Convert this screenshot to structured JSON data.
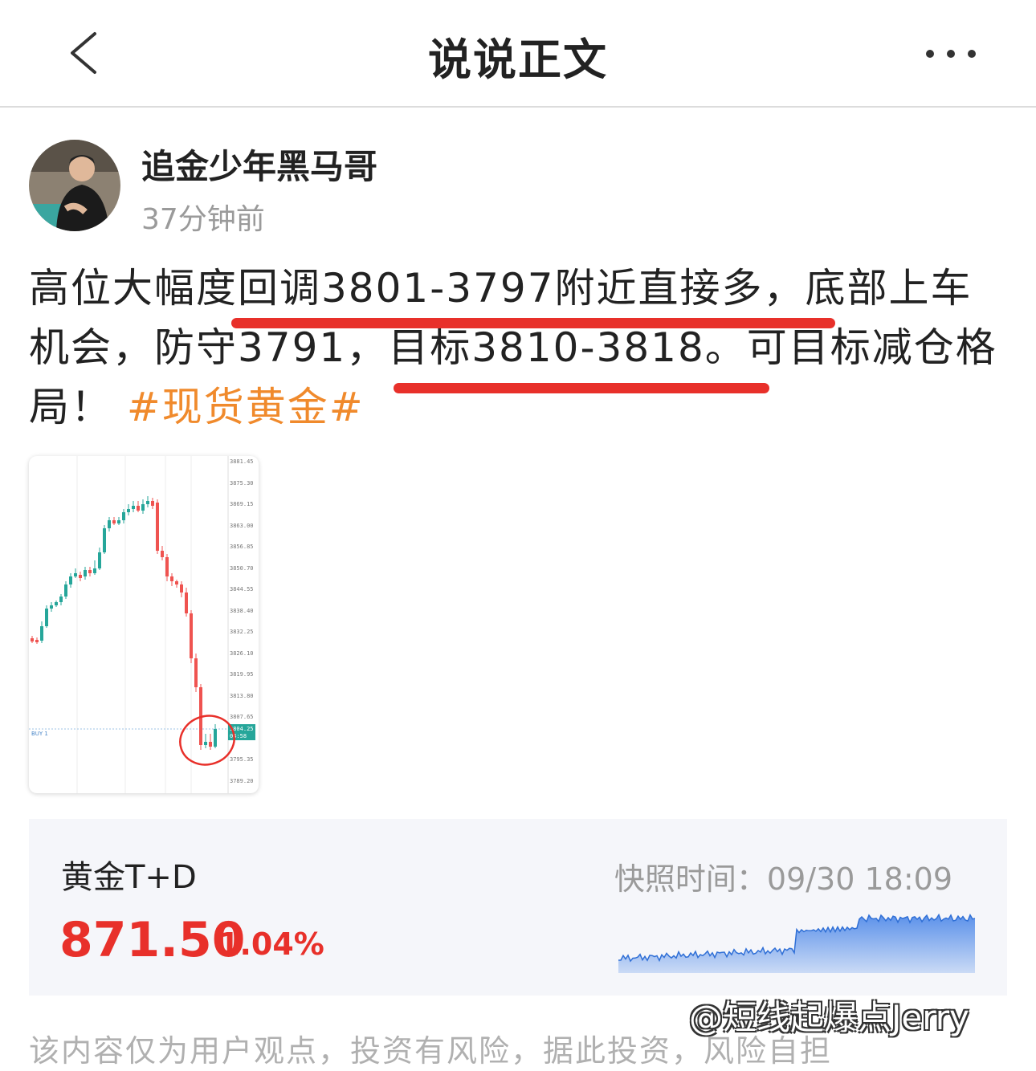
{
  "header": {
    "title": "说说正文",
    "back_icon": "chevron-left-icon",
    "more_icon": "more-dots-icon"
  },
  "post": {
    "author": "追金少年黑马哥",
    "time": "37分钟前",
    "text_line1": "高位大幅度回调3801-3797附近直接多，底部上车",
    "text_line2": "机会，防守3791，目标3810-3818。可目标减仓格",
    "text_line3": "局！",
    "hashtag": "#现货黄金#",
    "highlight_color": "#e8302a",
    "tag_color": "#f08a2c"
  },
  "chart_thumbnail": {
    "price_labels": [
      "3881.45",
      "3875.30",
      "3869.15",
      "3863.00",
      "3856.85",
      "3850.70",
      "3844.55",
      "3838.40",
      "3832.25",
      "3826.10",
      "3819.95",
      "3813.80",
      "3807.65",
      "3795.35",
      "3789.20"
    ],
    "order_label": "BUY 1",
    "current_price": "3804.25",
    "current_tag2": "04:58",
    "up_color": "#26a69a",
    "down_color": "#ef5350"
  },
  "quote_card": {
    "name": "黄金T+D",
    "snapshot": "快照时间：09/30 18:09",
    "price": "871.50",
    "change_pct": "1.04%",
    "accent": "#e8302a",
    "sparkline_color": "#4a86e8"
  },
  "footer": {
    "disclaimer": "该内容仅为用户观点，投资有风险，据此投资，风险自担",
    "watermark": "@短线起爆点Jerry"
  }
}
